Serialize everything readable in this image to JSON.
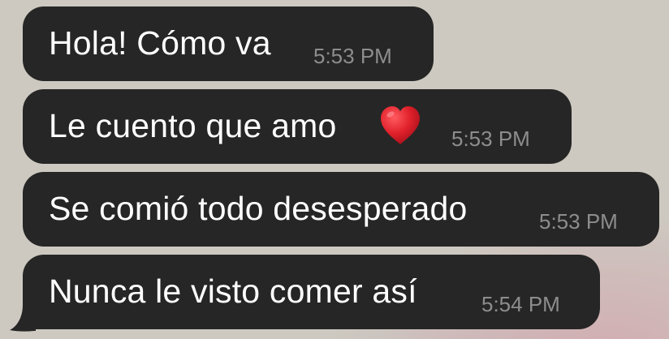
{
  "conversation": {
    "messages": [
      {
        "text": "Hola! Cómo va",
        "time": "5:53 PM"
      },
      {
        "text": "Le cuento que amo",
        "emoji": "heart-emoji",
        "time": "5:53 PM"
      },
      {
        "text": "Se comió todo desesperado",
        "time": "5:53 PM"
      },
      {
        "text": "Nunca le visto comer así",
        "time": "5:54 PM"
      }
    ]
  },
  "colors": {
    "bubble": "#262626",
    "message_text": "#ffffff",
    "timestamp": "#8d8d8d",
    "heart": "#e0212b",
    "background": "#cdc9c1"
  }
}
